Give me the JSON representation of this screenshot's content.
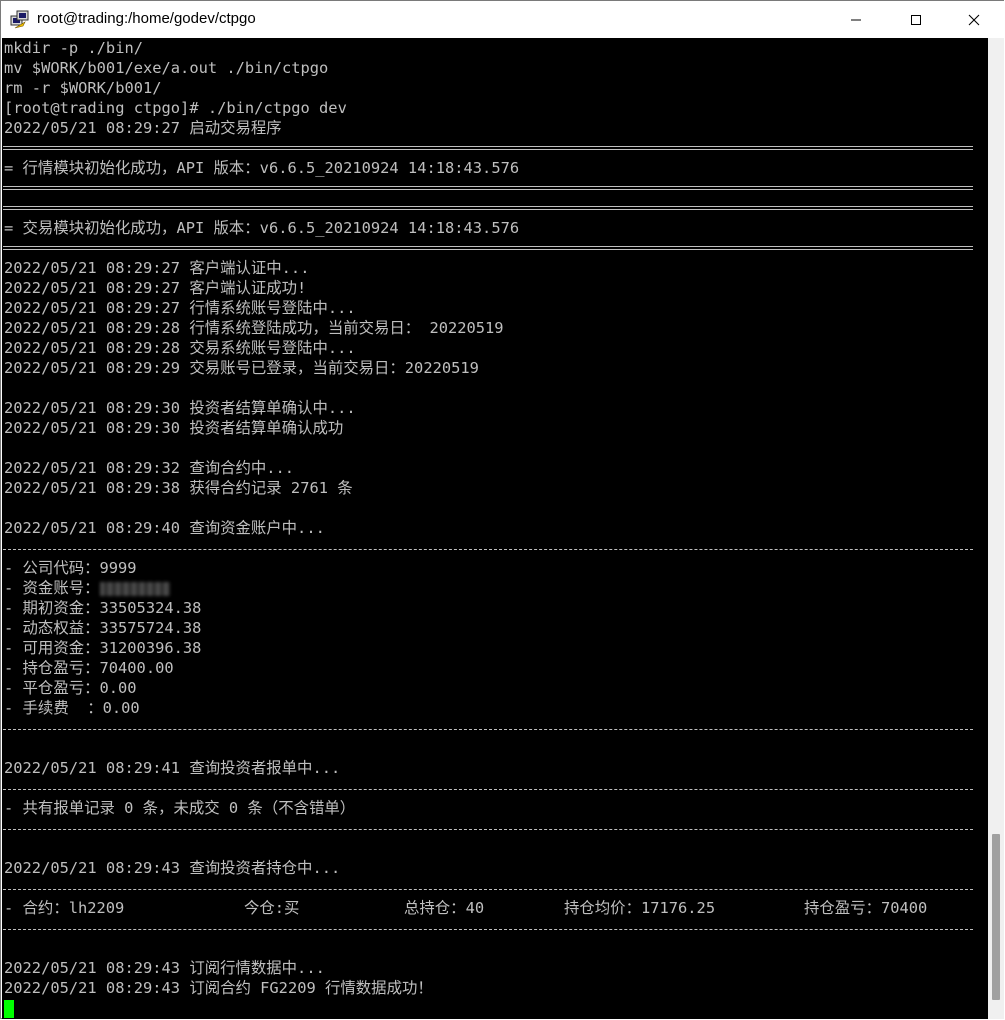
{
  "window": {
    "title": "root@trading:/home/godev/ctpgo"
  },
  "icons": {
    "app": "putty-terminal-icon",
    "minimize": "minimize-icon",
    "maximize": "maximize-icon",
    "close": "close-icon"
  },
  "colors": {
    "terminal_bg": "#000000",
    "terminal_text": "#bfbfbf",
    "cursor": "#00ff00"
  },
  "terminal": {
    "lines": [
      "mkdir -p ./bin/",
      "mv $WORK/b001/exe/a.out ./bin/ctpgo",
      "rm -r $WORK/b001/",
      "[root@trading ctpgo]# ./bin/ctpgo dev",
      "2022/05/21 08:29:27 启动交易程序",
      "= 行情模块初始化成功，API 版本：v6.6.5_20210924 14:18:43.576",
      "= 交易模块初始化成功，API 版本：v6.6.5_20210924 14:18:43.576",
      "2022/05/21 08:29:27 客户端认证中...",
      "2022/05/21 08:29:27 客户端认证成功!",
      "2022/05/21 08:29:27 行情系统账号登陆中...",
      "2022/05/21 08:29:28 行情系统登陆成功，当前交易日： 20220519",
      "2022/05/21 08:29:28 交易系统账号登陆中...",
      "2022/05/21 08:29:29 交易账号已登录，当前交易日：20220519",
      "2022/05/21 08:29:30 投资者结算单确认中...",
      "2022/05/21 08:29:30 投资者结算单确认成功",
      "2022/05/21 08:29:32 查询合约中...",
      "2022/05/21 08:29:38 获得合约记录 2761 条",
      "2022/05/21 08:29:40 查询资金账户中...",
      "- 公司代码：9999",
      "- 资金账号：",
      "- 期初资金：33505324.38",
      "- 动态权益：33575724.38",
      "- 可用资金：31200396.38",
      "- 持仓盈亏：70400.00",
      "- 平仓盈亏：0.00",
      "- 手续费  ：0.00",
      "2022/05/21 08:29:41 查询投资者报单中...",
      "- 共有报单记录 0 条，未成交 0 条（不含错单）",
      "2022/05/21 08:29:43 查询投资者持仓中...",
      "2022/05/21 08:29:43 订阅行情数据中...",
      "2022/05/21 08:29:43 订阅合约 FG2209 行情数据成功！"
    ],
    "position": {
      "contract": "- 合约：lh2209",
      "today": "今仓:买",
      "total": "总持仓：40",
      "avg_price": "持仓均价：17176.25",
      "pnl": "持仓盈亏：70400"
    }
  }
}
